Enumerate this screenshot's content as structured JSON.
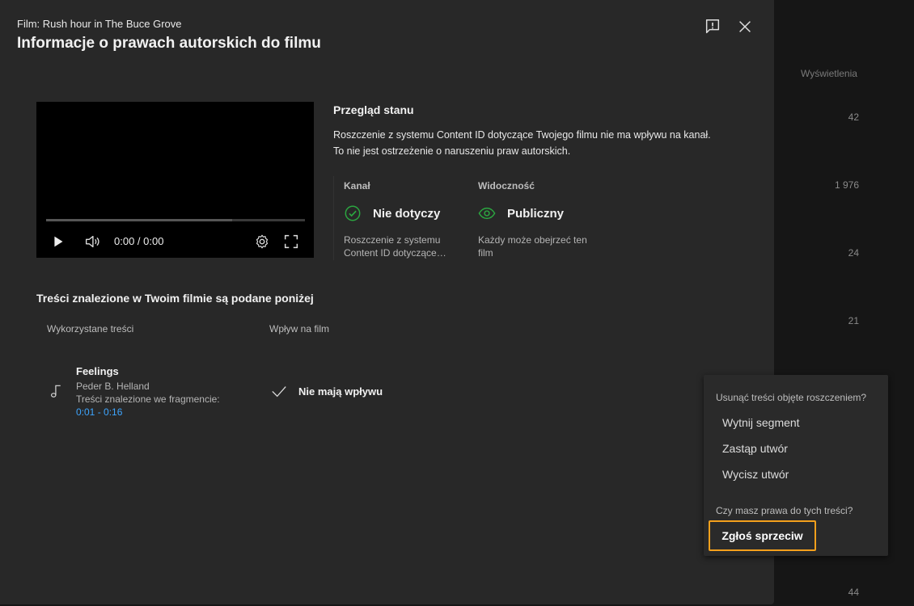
{
  "background": {
    "column_header": "Wyświetlenia",
    "values": [
      "42",
      "1 976",
      "24",
      "21",
      "44"
    ]
  },
  "dialog": {
    "film_line": "Film: Rush hour in The Buce Grove",
    "title": "Informacje o prawach autorskich do filmu",
    "header_icons": [
      "feedback-icon",
      "close-icon"
    ]
  },
  "player": {
    "time": "0:00 / 0:00",
    "buffer_fraction": 0.72,
    "controls": [
      "play-icon",
      "volume-icon",
      "settings-icon",
      "fullscreen-icon"
    ]
  },
  "status": {
    "title": "Przegląd stanu",
    "desc_line1": "Roszczenie z systemu Content ID dotyczące Twojego filmu nie ma wpływu na kanał.",
    "desc_line2": "To nie jest ostrzeżenie o naruszeniu praw autorskich.",
    "channel": {
      "label": "Kanał",
      "value": "Nie dotyczy",
      "text_line1": "Roszczenie z systemu",
      "text_line2": "Content ID dotyczące…",
      "icon": "check-circle-icon",
      "color": "#2ba640"
    },
    "visibility": {
      "label": "Widoczność",
      "value": "Publiczny",
      "text_line1": "Każdy może obejrzeć ten",
      "text_line2": "film",
      "icon": "eye-icon",
      "color": "#2ba640"
    }
  },
  "content": {
    "section_title": "Treści znalezione w Twoim filmie są podane poniżej",
    "col_used": "Wykorzystane treści",
    "col_impact": "Wpływ na film",
    "item": {
      "title": "Feelings",
      "artist": "Peder B. Helland",
      "fragment_label": "Treści znalezione we fragmencie:",
      "range": "0:01 - 0:16",
      "impact": "Nie mają wpływu"
    }
  },
  "menu": {
    "question1": "Usunąć treści objęte roszczeniem?",
    "items": [
      "Wytnij segment",
      "Zastąp utwór",
      "Wycisz utwór"
    ],
    "question2": "Czy masz prawa do tych treści?",
    "dispute": "Zgłoś sprzeciw",
    "highlight_color": "#f4a01c"
  }
}
